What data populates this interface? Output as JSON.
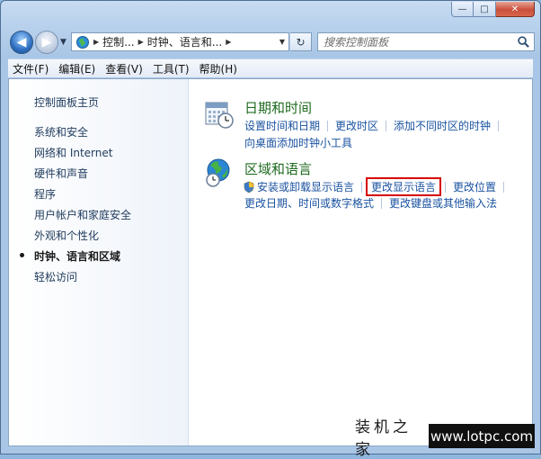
{
  "window": {
    "caption": {
      "minimize": "—",
      "maximize": "□",
      "close": "✕"
    }
  },
  "nav": {
    "address_segments": [
      "控制...",
      "时钟、语言和..."
    ],
    "search_placeholder": "搜索控制面板"
  },
  "menubar": {
    "items": [
      "文件(F)",
      "编辑(E)",
      "查看(V)",
      "工具(T)",
      "帮助(H)"
    ]
  },
  "sidebar": {
    "home": "控制面板主页",
    "items": [
      {
        "label": "系统和安全",
        "active": false
      },
      {
        "label": "网络和 Internet",
        "active": false
      },
      {
        "label": "硬件和声音",
        "active": false
      },
      {
        "label": "程序",
        "active": false
      },
      {
        "label": "用户帐户和家庭安全",
        "active": false
      },
      {
        "label": "外观和个性化",
        "active": false
      },
      {
        "label": "时钟、语言和区域",
        "active": true
      },
      {
        "label": "轻松访问",
        "active": false
      }
    ]
  },
  "main": {
    "datetime": {
      "title": "日期和时间",
      "links_row1": [
        "设置时间和日期",
        "更改时区",
        "添加不同时区的时钟"
      ],
      "links_row2": [
        "向桌面添加时钟小工具"
      ]
    },
    "region": {
      "title": "区域和语言",
      "links_row1": [
        "安装或卸载显示语言",
        "更改显示语言",
        "更改位置"
      ],
      "links_row2": [
        "更改日期、时间或数字格式",
        "更改键盘或其他输入法"
      ],
      "highlighted": "更改显示语言"
    }
  },
  "watermark": {
    "text": "装机之家",
    "url": "www.lotpc.com"
  },
  "colors": {
    "link": "#1a52a0",
    "category_title": "#1f6b20",
    "highlight": "#d60000"
  }
}
